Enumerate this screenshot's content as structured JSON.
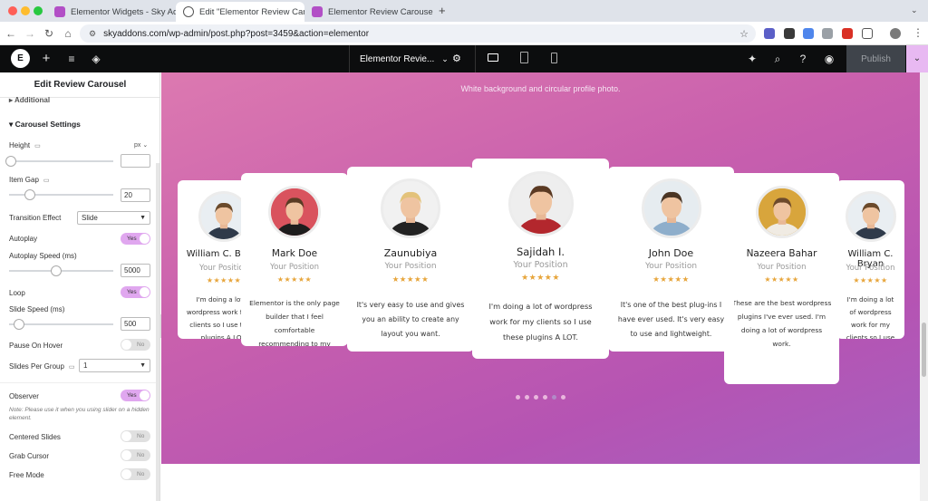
{
  "browser": {
    "tabs": [
      {
        "title": "Elementor Widgets - Sky Addo",
        "active": false
      },
      {
        "title": "Edit \"Elementor Review Carous",
        "active": true
      },
      {
        "title": "Elementor Review Carousel W",
        "active": false
      }
    ],
    "url": "skyaddons.com/wp-admin/post.php?post=3459&action=elementor"
  },
  "editor": {
    "document_title": "Elementor Revie...",
    "publish_label": "Publish"
  },
  "panel": {
    "title": "Edit Review Carousel",
    "additional_label": "Additional",
    "section_label": "Carousel Settings",
    "height_label": "Height",
    "height_unit": "px",
    "height_value": "",
    "item_gap_label": "Item Gap",
    "item_gap_value": "20",
    "transition_label": "Transition Effect",
    "transition_value": "Slide",
    "autoplay_label": "Autoplay",
    "autoplay_value": "Yes",
    "autoplay_speed_label": "Autoplay Speed (ms)",
    "autoplay_speed_value": "5000",
    "loop_label": "Loop",
    "loop_value": "Yes",
    "slide_speed_label": "Slide Speed (ms)",
    "slide_speed_value": "500",
    "pause_label": "Pause On Hover",
    "pause_value": "No",
    "per_group_label": "Slides Per Group",
    "per_group_value": "1",
    "observer_label": "Observer",
    "observer_value": "Yes",
    "observer_note": "Note: Please use it when you using slider on a hidden element.",
    "centered_label": "Centered Slides",
    "centered_value": "No",
    "grab_label": "Grab Cursor",
    "grab_value": "No",
    "free_label": "Free Mode",
    "free_value": "No"
  },
  "canvas": {
    "subtitle": "White background and circular profile photo.",
    "stars": "★★★★★",
    "cards": [
      {
        "name": "William C. Bryan",
        "position": "Your Position",
        "text": "I'm doing a lot of wordpress work for my clients so I use these plugins A LOT.",
        "avatar_bg": "#e9eef2",
        "shirt": "#2f3a4a",
        "hair": "#6b4a2b"
      },
      {
        "name": "Mark Doe",
        "position": "Your Position",
        "text": "Elementor is the only page builder that I feel comfortable recommending to my clients.",
        "avatar_bg": "#d9535e",
        "shirt": "#1d1d1d",
        "hair": "#5a3c24"
      },
      {
        "name": "Zaunubiya",
        "position": "Your Position",
        "text": "It's very easy to use and gives you an ability to create any layout you want.",
        "avatar_bg": "#f1f1f1",
        "shirt": "#222222",
        "hair": "#e3c27a"
      },
      {
        "name": "Sajidah I.",
        "position": "Your Position",
        "text": "I'm doing a lot of wordpress work for my clients so I use these plugins A LOT.",
        "avatar_bg": "#eeeeee",
        "shirt": "#b3272d",
        "hair": "#5b3a23"
      },
      {
        "name": "John Doe",
        "position": "Your Position",
        "text": "It's one of the best plug-ins I have ever used. It's very easy to use and lightweight.",
        "avatar_bg": "#e6ecf0",
        "shirt": "#8eaecb",
        "hair": "#4a3524"
      },
      {
        "name": "Nazeera Bahar",
        "position": "Your Position",
        "text": "These are the best wordpress plugins I've ever used. I'm doing a lot of wordpress work.",
        "avatar_bg": "#d8a53c",
        "shirt": "#f0ebe3",
        "hair": "#6d4a2c"
      },
      {
        "name": "William C. Bryan",
        "position": "Your Position",
        "text": "I'm doing a lot of wordpress work for my clients so I use these plugins A LOT.",
        "avatar_bg": "#e9eef2",
        "shirt": "#2f3a4a",
        "hair": "#6b4a2b"
      }
    ],
    "pagination_count": 6,
    "active_page": 5
  }
}
